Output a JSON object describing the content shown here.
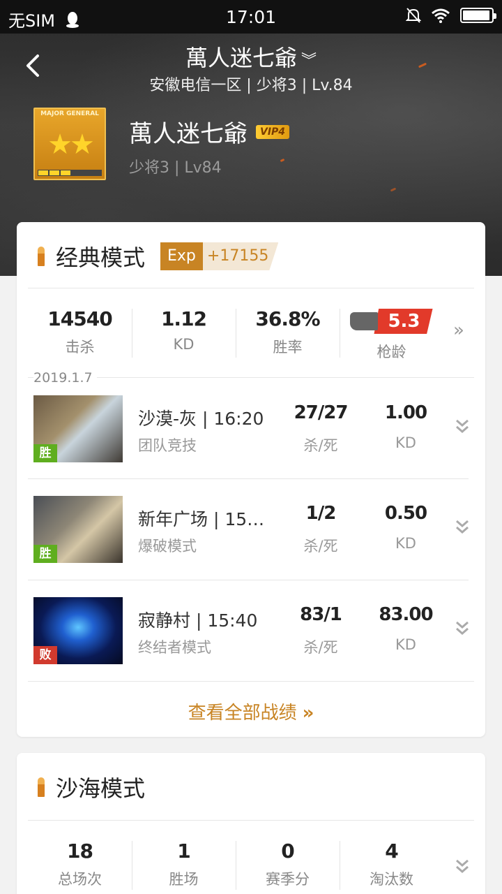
{
  "status_bar": {
    "carrier": "无SIM",
    "time": "17:01"
  },
  "header": {
    "title": "萬人迷七爺",
    "subtitle": "安徽电信一区 | 少将3 | Lv.84"
  },
  "profile": {
    "rank_badge_text": "MAJOR GENERAL",
    "name": "萬人迷七爺",
    "vip": "VIP4",
    "rank_level": "少将3 | Lv84"
  },
  "classic": {
    "title": "经典模式",
    "exp_label": "Exp",
    "exp_value": "+17155",
    "stats": [
      {
        "value": "14540",
        "label": "击杀"
      },
      {
        "value": "1.12",
        "label": "KD"
      },
      {
        "value": "36.8%",
        "label": "胜率"
      },
      {
        "value": "5.3",
        "label": "枪龄"
      }
    ],
    "date": "2019.1.7",
    "matches": [
      {
        "result": "胜",
        "map": "沙漠-灰 | 16:20",
        "mode": "团队竞技",
        "kills_deaths": "27/27",
        "kd_label": "杀/死",
        "kd": "1.00",
        "kd2_label": "KD"
      },
      {
        "result": "胜",
        "map": "新年广场 | 15…",
        "mode": "爆破模式",
        "kills_deaths": "1/2",
        "kd_label": "杀/死",
        "kd": "0.50",
        "kd2_label": "KD"
      },
      {
        "result": "败",
        "map": "寂静村 | 15:40",
        "mode": "终结者模式",
        "kills_deaths": "83/1",
        "kd_label": "杀/死",
        "kd": "83.00",
        "kd2_label": "KD"
      }
    ],
    "view_all": "查看全部战绩"
  },
  "sand": {
    "title": "沙海模式",
    "stats": [
      {
        "value": "18",
        "label": "总场次"
      },
      {
        "value": "1",
        "label": "胜场"
      },
      {
        "value": "0",
        "label": "赛季分"
      },
      {
        "value": "4",
        "label": "淘汰数"
      }
    ]
  },
  "colors": {
    "accent": "#c88424",
    "win": "#5fae1f",
    "lose": "#d13a2e",
    "gun_tag": "#e23a2a"
  }
}
